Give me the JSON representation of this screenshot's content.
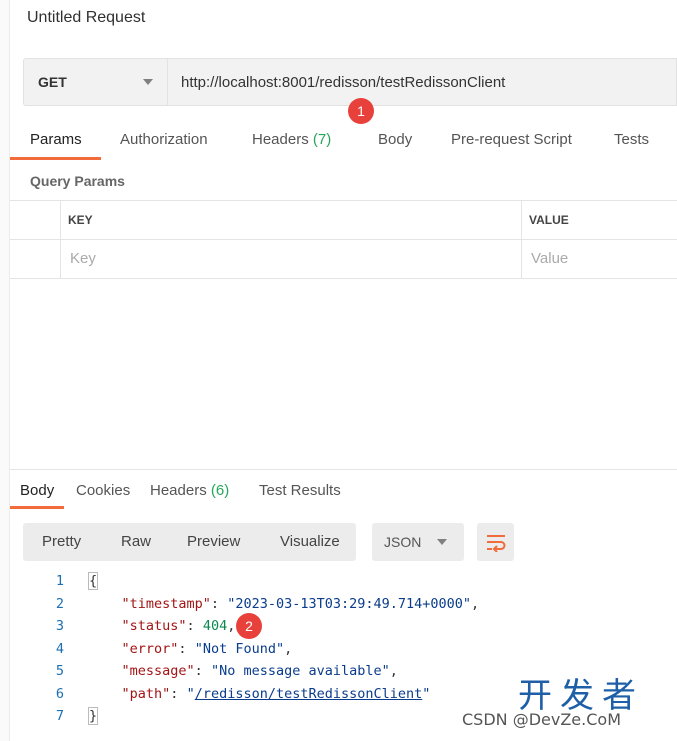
{
  "request": {
    "title": "Untitled Request",
    "method": "GET",
    "url": "http://localhost:8001/redisson/testRedissonClient"
  },
  "annotations": {
    "badge1": "1",
    "badge2": "2"
  },
  "request_tabs": {
    "params": "Params",
    "authorization": "Authorization",
    "headers": "Headers",
    "headers_count": "(7)",
    "body": "Body",
    "prerequest": "Pre-request Script",
    "tests": "Tests"
  },
  "query_params": {
    "label": "Query Params",
    "col_key": "KEY",
    "col_value": "VALUE",
    "key_placeholder": "Key",
    "value_placeholder": "Value"
  },
  "response_tabs": {
    "body": "Body",
    "cookies": "Cookies",
    "headers": "Headers",
    "headers_count": "(6)",
    "test_results": "Test Results"
  },
  "toolbar": {
    "pretty": "Pretty",
    "raw": "Raw",
    "preview": "Preview",
    "visualize": "Visualize",
    "format": "JSON"
  },
  "response_body": {
    "line_numbers": [
      "1",
      "2",
      "3",
      "4",
      "5",
      "6",
      "7"
    ],
    "open_brace": "{",
    "close_brace": "}",
    "timestamp_key": "\"timestamp\"",
    "timestamp_value": "\"2023-03-13T03:29:49.714+0000\"",
    "status_key": "\"status\"",
    "status_value": "404",
    "error_key": "\"error\"",
    "error_value": "\"Not Found\"",
    "message_key": "\"message\"",
    "message_value": "\"No message available\"",
    "path_key": "\"path\"",
    "path_value": "/redisson/testRedissonClient"
  },
  "watermark": {
    "big": "开发者",
    "small": "CSDN @DevZe.CoM"
  },
  "colors": {
    "accent": "#f26b3a",
    "badge": "#e8413b",
    "count_green": "#26a65b"
  }
}
